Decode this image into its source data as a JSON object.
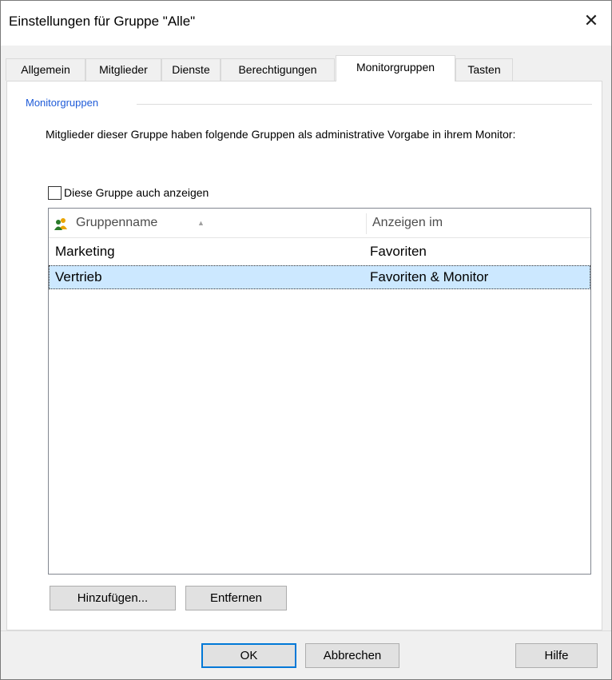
{
  "dialog": {
    "title": "Einstellungen für Gruppe \"Alle\"",
    "close_glyph": "✕"
  },
  "tabs": [
    {
      "label": "Allgemein"
    },
    {
      "label": "Mitglieder"
    },
    {
      "label": "Dienste"
    },
    {
      "label": "Berechtigungen"
    },
    {
      "label": "Monitorgruppen",
      "active": true
    },
    {
      "label": "Tasten"
    }
  ],
  "section": {
    "label": "Monitorgruppen",
    "description": "Mitglieder dieser Gruppe haben folgende Gruppen als administrative Vorgabe in ihrem Monitor:"
  },
  "checkbox": {
    "label": "Diese Gruppe auch anzeigen",
    "checked": false
  },
  "list": {
    "columns": {
      "name": "Gruppenname",
      "show_in": "Anzeigen im"
    },
    "rows": [
      {
        "name": "Marketing",
        "show_in": "Favoriten",
        "selected": false
      },
      {
        "name": "Vertrieb",
        "show_in": "Favoriten & Monitor",
        "selected": true
      }
    ]
  },
  "buttons": {
    "add": "Hinzufügen...",
    "remove": "Entfernen",
    "ok": "OK",
    "cancel": "Abbrechen",
    "help": "Hilfe"
  },
  "colors": {
    "accent_blue": "#0078d7",
    "selection": "#cce8ff",
    "section_label": "#1e5bd8"
  }
}
